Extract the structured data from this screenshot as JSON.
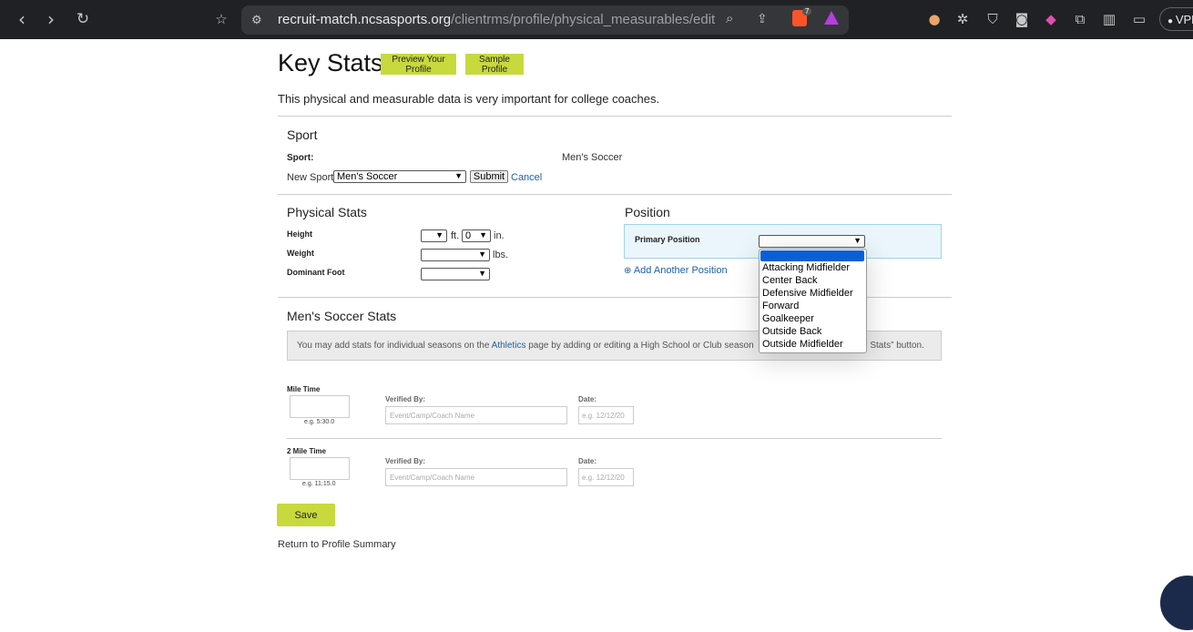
{
  "browser": {
    "url_host": "recruit-match.ncsasports.org",
    "url_path": "/clientrms/profile/physical_measurables/edit",
    "tab_badge": "7",
    "vpn_label": "VPN"
  },
  "header": {
    "title": "Key Stats",
    "preview_btn": "Preview Your Profile",
    "sample_btn": "Sample Profile",
    "intro": "This physical and measurable data is very important for college coaches."
  },
  "sport": {
    "heading": "Sport",
    "label": "Sport:",
    "value": "Men's Soccer",
    "new_label": "New Sport:",
    "new_selected": "Men's Soccer",
    "submit": "Submit",
    "cancel": "Cancel"
  },
  "physical": {
    "heading": "Physical Stats",
    "height_label": "Height",
    "height_ft_value": "",
    "ft_unit": "ft.",
    "height_in_value": "0",
    "in_unit": "in.",
    "weight_label": "Weight",
    "weight_unit": "lbs.",
    "foot_label": "Dominant Foot"
  },
  "position": {
    "heading": "Position",
    "primary_label": "Primary Position",
    "add_another": "Add Another Position",
    "options": [
      "Attacking Midfielder",
      "Center Back",
      "Defensive Midfielder",
      "Forward",
      "Goalkeeper",
      "Outside Back",
      "Outside Midfielder"
    ]
  },
  "soccer_stats": {
    "heading": "Men's Soccer Stats",
    "info_pre": "You may add stats for individual seasons on the ",
    "info_link": "Athletics",
    "info_mid": " page by adding or editing a High School or Club season",
    "info_end": "d Stats” button.",
    "mile": {
      "label": "Mile Time",
      "hint": "e.g. 5:30.0",
      "verified_label": "Verified By:",
      "verified_placeholder": "Event/Camp/Coach Name",
      "date_label": "Date:",
      "date_placeholder": "e.g. 12/12/20"
    },
    "two_mile": {
      "label": "2 Mile Time",
      "hint": "e.g. 11:15.0",
      "verified_label": "Verified By:",
      "verified_placeholder": "Event/Camp/Coach Name",
      "date_label": "Date:",
      "date_placeholder": "e.g. 12/12/20"
    }
  },
  "footer": {
    "save": "Save",
    "return_link": "Return to Profile Summary"
  },
  "colors": {
    "accent_green": "#c7d93d",
    "link_blue": "#1f5fa6",
    "selection_blue": "#0b5fd6"
  }
}
